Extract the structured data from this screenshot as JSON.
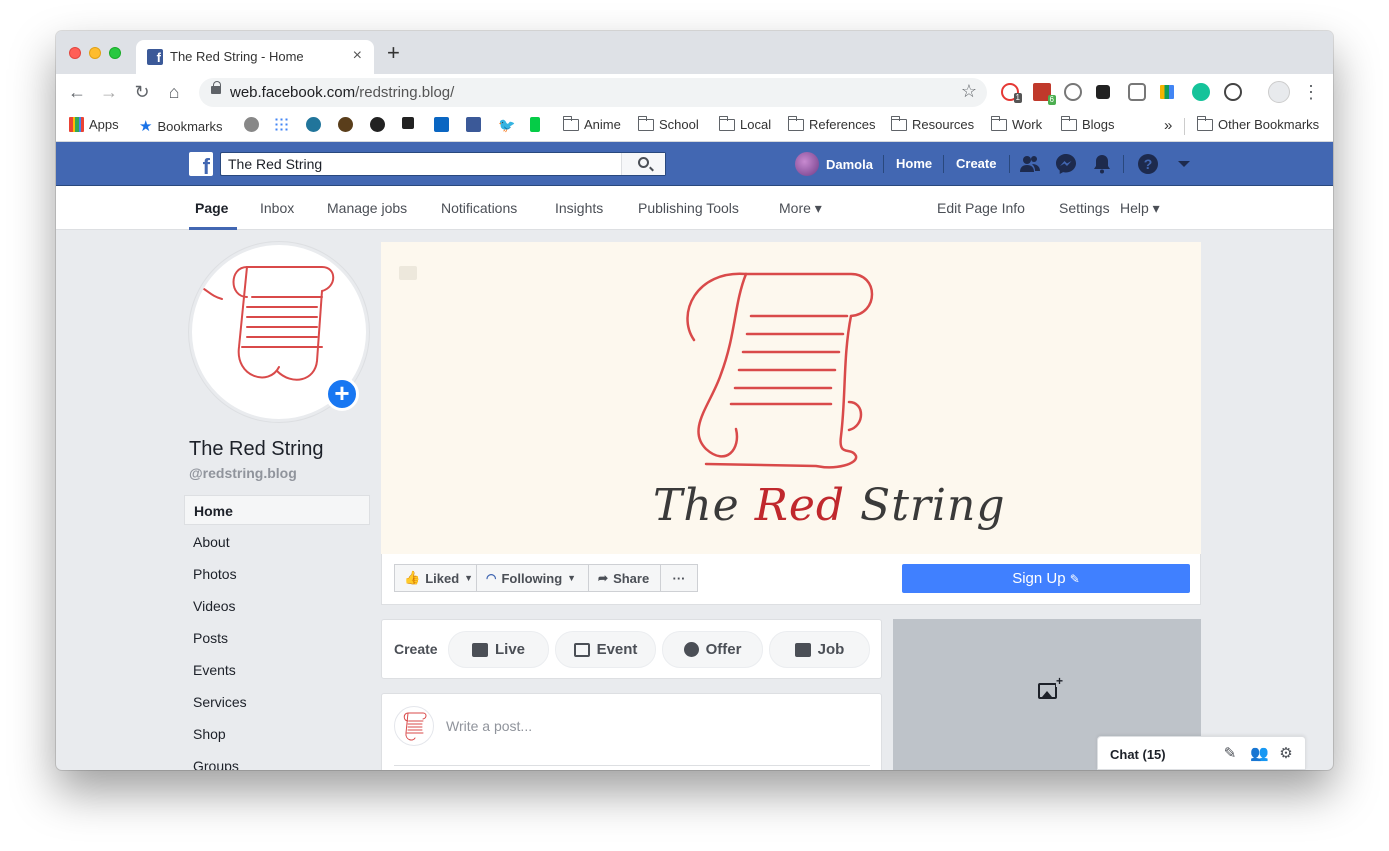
{
  "browser": {
    "tab_title": "The Red String - Home",
    "url_host": "web.facebook.com",
    "url_path": "/redstring.blog/",
    "extension_badges": [
      "1",
      "6"
    ]
  },
  "bookmarks": [
    {
      "label": "Apps",
      "icon": "apps-grid-icon"
    },
    {
      "label": "Bookmarks",
      "icon": "star-icon"
    },
    {
      "label": "Anime",
      "icon": "folder-icon"
    },
    {
      "label": "School",
      "icon": "folder-icon"
    },
    {
      "label": "Local",
      "icon": "folder-icon"
    },
    {
      "label": "References",
      "icon": "folder-icon"
    },
    {
      "label": "Resources",
      "icon": "folder-icon"
    },
    {
      "label": "Work",
      "icon": "folder-icon"
    },
    {
      "label": "Blogs",
      "icon": "folder-icon"
    },
    {
      "label": "Other Bookmarks",
      "icon": "folder-icon"
    }
  ],
  "bookmarks_overflow": "»",
  "fb": {
    "search_value": "The Red String",
    "user_name": "Damola",
    "home_link": "Home",
    "create_link": "Create"
  },
  "page_nav": {
    "left": [
      "Page",
      "Inbox",
      "Manage jobs",
      "Notifications",
      "Insights",
      "Publishing Tools",
      "More ▾"
    ],
    "right": [
      "Edit Page Info",
      "Settings",
      "Help ▾"
    ]
  },
  "page": {
    "name": "The Red String",
    "handle": "@redstring.blog",
    "cover_title_1": "The ",
    "cover_title_2": "Red",
    "cover_title_3": " String"
  },
  "sidebar": [
    "Home",
    "About",
    "Photos",
    "Videos",
    "Posts",
    "Events",
    "Services",
    "Shop",
    "Groups"
  ],
  "actions": {
    "liked": "Liked",
    "following": "Following",
    "share": "Share",
    "more": "···",
    "signup": "Sign Up"
  },
  "create": {
    "label": "Create",
    "buttons": [
      "Live",
      "Event",
      "Offer",
      "Job"
    ]
  },
  "post": {
    "placeholder": "Write a post..."
  },
  "chat": {
    "label": "Chat (15)"
  },
  "colors": {
    "fb_blue": "#4267b2",
    "signup_blue": "#4080ff",
    "logo_red": "#d94a4a"
  }
}
